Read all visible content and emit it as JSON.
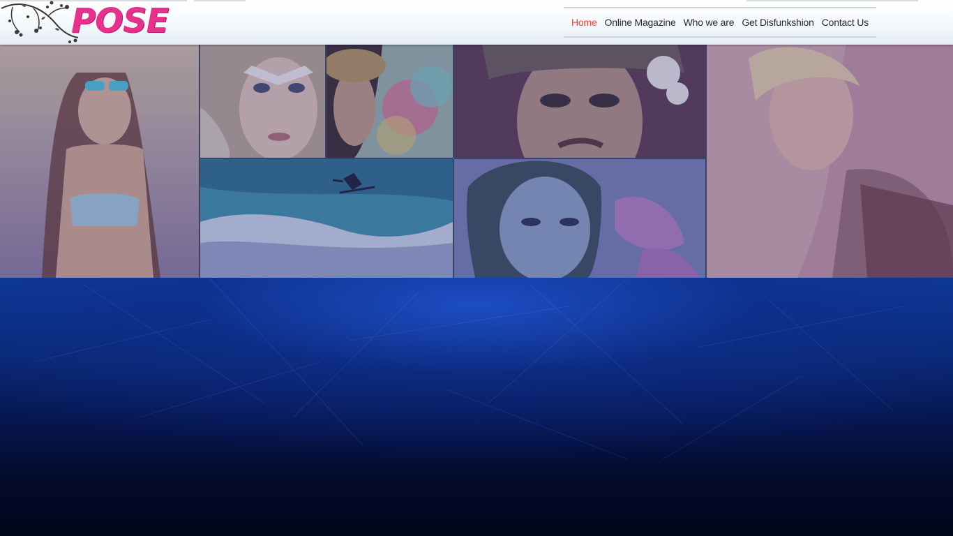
{
  "site": {
    "logo_text": "POSE"
  },
  "nav": {
    "items": [
      {
        "label": "Home",
        "active": true
      },
      {
        "label": "Online Magazine",
        "active": false
      },
      {
        "label": "Who we are",
        "active": false
      },
      {
        "label": "Get Disfunkshion",
        "active": false
      },
      {
        "label": "Contact Us",
        "active": false
      }
    ]
  },
  "colors": {
    "brand_pink": "#e8318c",
    "nav_active": "#e0443c",
    "nav_text": "#2a2a2a",
    "background_blue": "#0f3b9a"
  },
  "hero": {
    "tiles": [
      {
        "name": "girl-beach-sunglasses"
      },
      {
        "name": "face-white-paint"
      },
      {
        "name": "girl-hat-sunglasses"
      },
      {
        "name": "woman-flower-hair"
      },
      {
        "name": "blonde-profile"
      },
      {
        "name": "surfer-wave"
      },
      {
        "name": "woman-headscarf"
      }
    ]
  }
}
